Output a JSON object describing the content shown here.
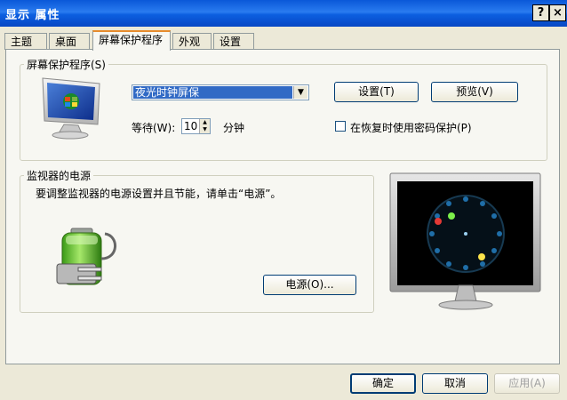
{
  "window": {
    "title": "显示 属性",
    "help_label": "?",
    "close_label": "×"
  },
  "tabs": [
    {
      "label": "主题"
    },
    {
      "label": "桌面"
    },
    {
      "label": "屏幕保护程序",
      "active": true
    },
    {
      "label": "外观"
    },
    {
      "label": "设置"
    }
  ],
  "screensaver": {
    "legend": "屏幕保护程序(S)",
    "selected": "夜光时钟屏保",
    "settings_button": "设置(T)",
    "preview_button": "预览(V)",
    "wait_label": "等待(W):",
    "wait_value": "10",
    "minutes_label": "分钟",
    "password_checkbox_label": "在恢复时使用密码保护(P)",
    "password_checked": false
  },
  "power": {
    "legend": "监视器的电源",
    "description": "要调整监视器的电源设置并且节能，请单击“电源”。",
    "power_button": "电源(O)..."
  },
  "dialog_buttons": {
    "ok": "确定",
    "cancel": "取消",
    "apply": "应用(A)"
  }
}
